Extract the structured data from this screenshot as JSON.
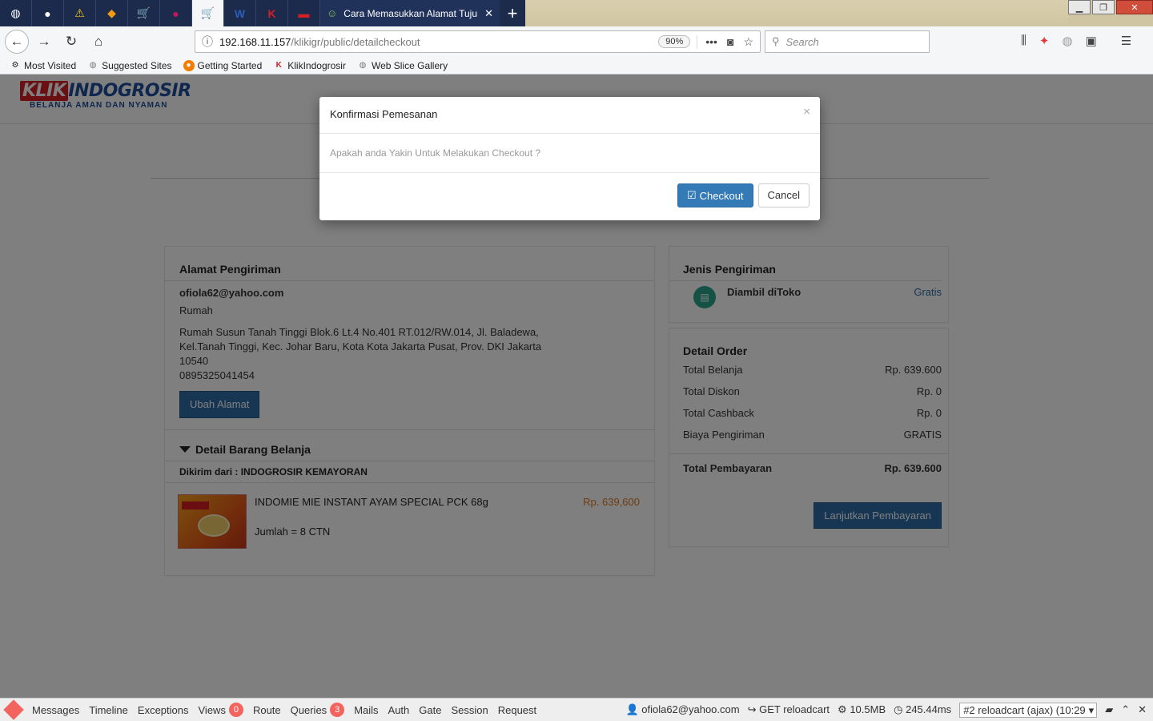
{
  "browser": {
    "tab_title": "Cara Memasukkan Alamat Tuju",
    "url_host": "192.168.11.157",
    "url_path": "/klikigr/public/detailcheckout",
    "zoom": "90%",
    "search_placeholder": "Search",
    "bookmarks": [
      "Most Visited",
      "Suggested Sites",
      "Getting Started",
      "KlikIndogrosir",
      "Web Slice Gallery"
    ]
  },
  "site": {
    "logo_klik": "KLIK",
    "logo_indo": "INDOGROSIR",
    "logo_tagline": "BELANJA AMAN DAN NYAMAN"
  },
  "address": {
    "title": "Alamat Pengiriman",
    "email": "ofiola62@yahoo.com",
    "label": "Rumah",
    "line1": "Rumah Susun Tanah Tinggi Blok.6 Lt.4 No.401 RT.012/RW.014, Jl. Baladewa,",
    "line2": "Kel.Tanah Tinggi, Kec. Johar Baru, Kota Kota Jakarta Pusat, Prov. DKI Jakarta",
    "postal": "10540",
    "phone": "0895325041454",
    "change_button": "Ubah Alamat"
  },
  "items_section": {
    "title": "Detail Barang Belanja",
    "ship_from": "Dikirim dari : INDOGROSIR KEMAYORAN",
    "items": [
      {
        "name": "INDOMIE MIE INSTANT AYAM SPECIAL PCK 68g",
        "qty": "Jumlah = 8 CTN",
        "price": "Rp. 639,600"
      }
    ]
  },
  "shipping": {
    "title": "Jenis Pengiriman",
    "method": "Diambil diToko",
    "price": "Gratis"
  },
  "order": {
    "title": "Detail Order",
    "rows": [
      {
        "label": "Total Belanja",
        "value": "Rp. 639.600"
      },
      {
        "label": "Total Diskon",
        "value": "Rp. 0"
      },
      {
        "label": "Total Cashback",
        "value": "Rp. 0"
      },
      {
        "label": "Biaya Pengiriman",
        "value": "GRATIS"
      }
    ],
    "total_label": "Total Pembayaran",
    "total_value": "Rp. 639.600",
    "continue_button": "Lanjutkan Pembayaran"
  },
  "modal": {
    "title": "Konfirmasi Pemesanan",
    "close": "×",
    "message": "Apakah anda Yakin Untuk Melakukan Checkout ?",
    "confirm": "Checkout",
    "cancel": "Cancel"
  },
  "debugbar": {
    "tabs": [
      "Messages",
      "Timeline",
      "Exceptions",
      "Views",
      "Route",
      "Queries",
      "Mails",
      "Auth",
      "Gate",
      "Session",
      "Request"
    ],
    "views_count": "0",
    "queries_count": "3",
    "user": "ofiola62@yahoo.com",
    "request": "GET reloadcart",
    "memory": "10.5MB",
    "time": "245.44ms",
    "selected_request": "#2 reloadcart (ajax) (10:29"
  }
}
